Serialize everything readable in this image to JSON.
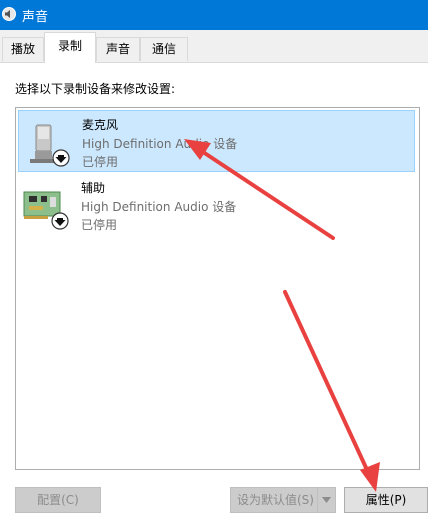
{
  "window": {
    "title": "声音"
  },
  "tabs": [
    {
      "label": "播放"
    },
    {
      "label": "录制"
    },
    {
      "label": "声音"
    },
    {
      "label": "通信"
    }
  ],
  "instruction": "选择以下录制设备来修改设置:",
  "devices": [
    {
      "name": "麦克风",
      "description": "High Definition Audio 设备",
      "status": "已停用",
      "icon": "microphone-icon",
      "selected": true
    },
    {
      "name": "辅助",
      "description": "High Definition Audio 设备",
      "status": "已停用",
      "icon": "line-in-board-icon",
      "selected": false
    }
  ],
  "buttons": {
    "configure": "配置(C)",
    "set_default": "设为默认值(S)",
    "properties": "属性(P)"
  },
  "colors": {
    "titlebar": "#0078d7",
    "selection": "#cce8ff",
    "annotation_arrow": "#e8413f"
  }
}
